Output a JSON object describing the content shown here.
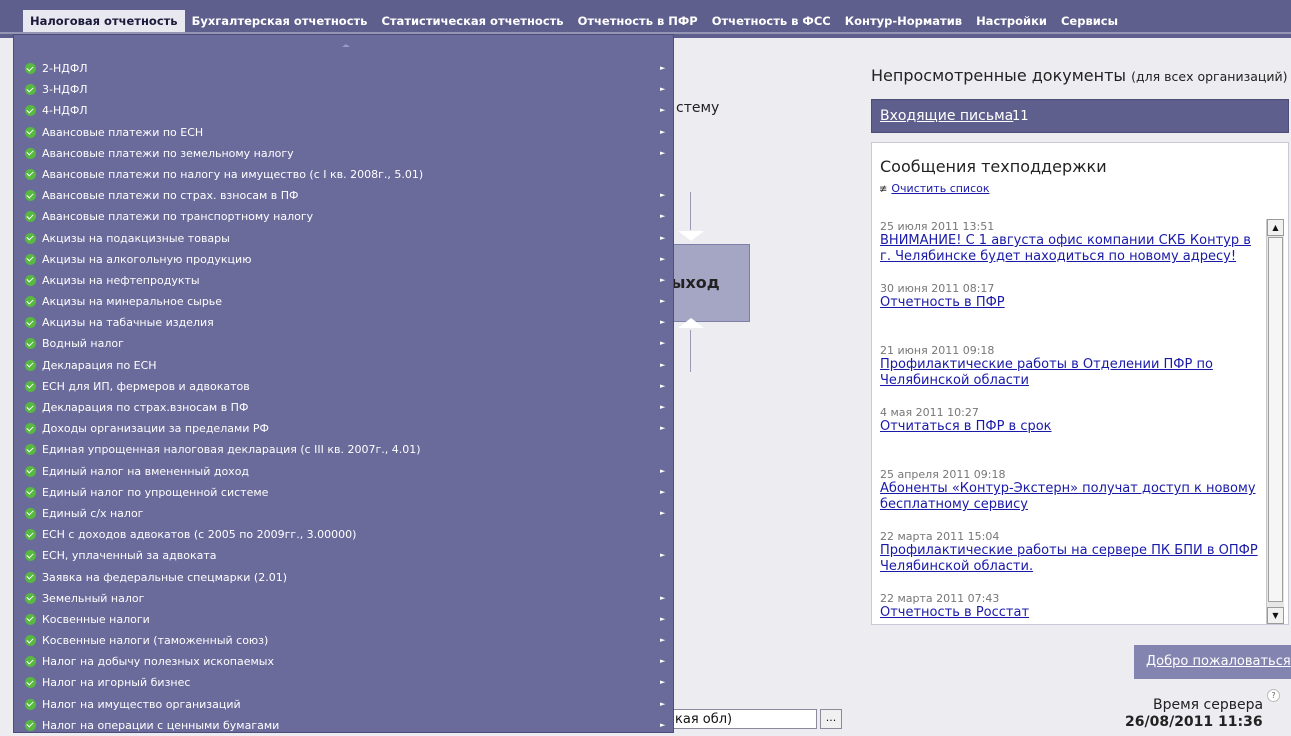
{
  "topnav": {
    "tabs": [
      "Налоговая отчетность",
      "Бухгалтерская отчетность",
      "Статистическая отчетность",
      "Отчетность в ПФР",
      "Отчетность в ФСС",
      "Контур-Норматив",
      "Настройки",
      "Сервисы"
    ]
  },
  "background": {
    "partial_text": "стему",
    "flow_box_label": "ыход",
    "region_input_value": "кая обл)",
    "region_button_label": "..."
  },
  "tax_menu": {
    "items": [
      {
        "label": "2-НДФЛ",
        "has_submenu": true
      },
      {
        "label": "3-НДФЛ",
        "has_submenu": true
      },
      {
        "label": "4-НДФЛ",
        "has_submenu": true
      },
      {
        "label": "Авансовые платежи по ЕСН",
        "has_submenu": true
      },
      {
        "label": "Авансовые платежи по земельному налогу",
        "has_submenu": true
      },
      {
        "label": "Авансовые платежи по налогу на имущество (с I кв. 2008г., 5.01)",
        "has_submenu": false
      },
      {
        "label": "Авансовые платежи по страх. взносам в ПФ",
        "has_submenu": true
      },
      {
        "label": "Авансовые платежи по транспортному налогу",
        "has_submenu": true
      },
      {
        "label": "Акцизы на подакцизные товары",
        "has_submenu": true
      },
      {
        "label": "Акцизы на алкогольную продукцию",
        "has_submenu": true
      },
      {
        "label": "Акцизы на нефтепродукты",
        "has_submenu": true
      },
      {
        "label": "Акцизы на минеральное сырье",
        "has_submenu": true
      },
      {
        "label": "Акцизы на табачные изделия",
        "has_submenu": true
      },
      {
        "label": "Водный налог",
        "has_submenu": true
      },
      {
        "label": "Декларация по ЕСН",
        "has_submenu": true
      },
      {
        "label": "ЕСН для ИП, фермеров и адвокатов",
        "has_submenu": true
      },
      {
        "label": "Декларация по страх.взносам в ПФ",
        "has_submenu": true
      },
      {
        "label": "Доходы организации за пределами РФ",
        "has_submenu": true
      },
      {
        "label": "Единая упрощенная налоговая декларация (с III кв. 2007г., 4.01)",
        "has_submenu": false
      },
      {
        "label": "Единый налог на вмененный доход",
        "has_submenu": true
      },
      {
        "label": "Единый налог по упрощенной системе",
        "has_submenu": true
      },
      {
        "label": "Единый с/х налог",
        "has_submenu": true
      },
      {
        "label": "ЕСН с доходов адвокатов (с 2005 по 2009гг., 3.00000)",
        "has_submenu": false
      },
      {
        "label": "ЕСН, уплаченный за адвоката",
        "has_submenu": true
      },
      {
        "label": "Заявка на федеральные спецмарки (2.01)",
        "has_submenu": false
      },
      {
        "label": "Земельный налог",
        "has_submenu": true
      },
      {
        "label": "Косвенные налоги",
        "has_submenu": true
      },
      {
        "label": "Косвенные налоги (таможенный союз)",
        "has_submenu": true
      },
      {
        "label": "Налог на добычу полезных ископаемых",
        "has_submenu": true
      },
      {
        "label": "Налог на игорный бизнес",
        "has_submenu": true
      },
      {
        "label": "Налог на имущество организаций",
        "has_submenu": true
      },
      {
        "label": "Налог на операции с ценными бумагами",
        "has_submenu": true
      }
    ],
    "submenu_arrow": "►"
  },
  "right_panel": {
    "unread_title": "Непросмотренные документы",
    "unread_scope": "(для всех организаций)",
    "incoming_link": "Входящие письма",
    "incoming_count": "11",
    "support_title": "Сообщения техподдержки",
    "clear_list": "Очистить список",
    "messages": [
      {
        "date": "25 июля 2011 13:51",
        "text": "ВНИМАНИЕ! С 1 августа офис компании СКБ Контур в г. Челябинске будет находиться по новому адресу!"
      },
      {
        "date": "30 июня 2011 08:17",
        "text": "Отчетность в ПФР"
      },
      {
        "date": "21 июня 2011 09:18",
        "text": "Профилактические работы в Отделении ПФР по Челябинской области"
      },
      {
        "date": "4 мая 2011 10:27",
        "text": "Отчитаться в ПФР в срок"
      },
      {
        "date": "25 апреля 2011 09:18",
        "text": "Абоненты «Контур-Экстерн» получат доступ к новому бесплатному сервису"
      },
      {
        "date": "22 марта 2011 15:04",
        "text": "Профилактические работы на сервере ПК БПИ в ОПФР Челябинской области."
      },
      {
        "date": "22 марта 2011 07:43",
        "text": "Отчетность в Росстат"
      }
    ],
    "welcome": "Добро пожаловаться",
    "server_time_label": "Время сервера",
    "server_time_help": "?",
    "server_time": "26/08/2011 11:36"
  },
  "colors": {
    "nav_bg": "#5f5f8d",
    "menu_bg": "#6a6a9b",
    "check_green": "#57b93f",
    "link_blue": "#1a1aa8"
  }
}
